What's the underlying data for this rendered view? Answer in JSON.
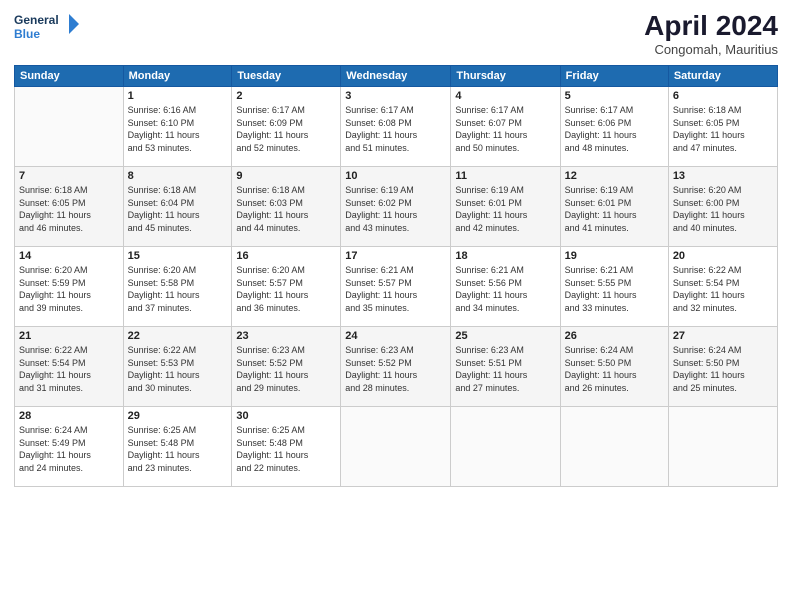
{
  "header": {
    "logo_line1": "General",
    "logo_line2": "Blue",
    "month_year": "April 2024",
    "location": "Congomah, Mauritius"
  },
  "days_of_week": [
    "Sunday",
    "Monday",
    "Tuesday",
    "Wednesday",
    "Thursday",
    "Friday",
    "Saturday"
  ],
  "weeks": [
    [
      {
        "day": "",
        "info": ""
      },
      {
        "day": "1",
        "info": "Sunrise: 6:16 AM\nSunset: 6:10 PM\nDaylight: 11 hours\nand 53 minutes."
      },
      {
        "day": "2",
        "info": "Sunrise: 6:17 AM\nSunset: 6:09 PM\nDaylight: 11 hours\nand 52 minutes."
      },
      {
        "day": "3",
        "info": "Sunrise: 6:17 AM\nSunset: 6:08 PM\nDaylight: 11 hours\nand 51 minutes."
      },
      {
        "day": "4",
        "info": "Sunrise: 6:17 AM\nSunset: 6:07 PM\nDaylight: 11 hours\nand 50 minutes."
      },
      {
        "day": "5",
        "info": "Sunrise: 6:17 AM\nSunset: 6:06 PM\nDaylight: 11 hours\nand 48 minutes."
      },
      {
        "day": "6",
        "info": "Sunrise: 6:18 AM\nSunset: 6:05 PM\nDaylight: 11 hours\nand 47 minutes."
      }
    ],
    [
      {
        "day": "7",
        "info": "Sunrise: 6:18 AM\nSunset: 6:05 PM\nDaylight: 11 hours\nand 46 minutes."
      },
      {
        "day": "8",
        "info": "Sunrise: 6:18 AM\nSunset: 6:04 PM\nDaylight: 11 hours\nand 45 minutes."
      },
      {
        "day": "9",
        "info": "Sunrise: 6:18 AM\nSunset: 6:03 PM\nDaylight: 11 hours\nand 44 minutes."
      },
      {
        "day": "10",
        "info": "Sunrise: 6:19 AM\nSunset: 6:02 PM\nDaylight: 11 hours\nand 43 minutes."
      },
      {
        "day": "11",
        "info": "Sunrise: 6:19 AM\nSunset: 6:01 PM\nDaylight: 11 hours\nand 42 minutes."
      },
      {
        "day": "12",
        "info": "Sunrise: 6:19 AM\nSunset: 6:01 PM\nDaylight: 11 hours\nand 41 minutes."
      },
      {
        "day": "13",
        "info": "Sunrise: 6:20 AM\nSunset: 6:00 PM\nDaylight: 11 hours\nand 40 minutes."
      }
    ],
    [
      {
        "day": "14",
        "info": "Sunrise: 6:20 AM\nSunset: 5:59 PM\nDaylight: 11 hours\nand 39 minutes."
      },
      {
        "day": "15",
        "info": "Sunrise: 6:20 AM\nSunset: 5:58 PM\nDaylight: 11 hours\nand 37 minutes."
      },
      {
        "day": "16",
        "info": "Sunrise: 6:20 AM\nSunset: 5:57 PM\nDaylight: 11 hours\nand 36 minutes."
      },
      {
        "day": "17",
        "info": "Sunrise: 6:21 AM\nSunset: 5:57 PM\nDaylight: 11 hours\nand 35 minutes."
      },
      {
        "day": "18",
        "info": "Sunrise: 6:21 AM\nSunset: 5:56 PM\nDaylight: 11 hours\nand 34 minutes."
      },
      {
        "day": "19",
        "info": "Sunrise: 6:21 AM\nSunset: 5:55 PM\nDaylight: 11 hours\nand 33 minutes."
      },
      {
        "day": "20",
        "info": "Sunrise: 6:22 AM\nSunset: 5:54 PM\nDaylight: 11 hours\nand 32 minutes."
      }
    ],
    [
      {
        "day": "21",
        "info": "Sunrise: 6:22 AM\nSunset: 5:54 PM\nDaylight: 11 hours\nand 31 minutes."
      },
      {
        "day": "22",
        "info": "Sunrise: 6:22 AM\nSunset: 5:53 PM\nDaylight: 11 hours\nand 30 minutes."
      },
      {
        "day": "23",
        "info": "Sunrise: 6:23 AM\nSunset: 5:52 PM\nDaylight: 11 hours\nand 29 minutes."
      },
      {
        "day": "24",
        "info": "Sunrise: 6:23 AM\nSunset: 5:52 PM\nDaylight: 11 hours\nand 28 minutes."
      },
      {
        "day": "25",
        "info": "Sunrise: 6:23 AM\nSunset: 5:51 PM\nDaylight: 11 hours\nand 27 minutes."
      },
      {
        "day": "26",
        "info": "Sunrise: 6:24 AM\nSunset: 5:50 PM\nDaylight: 11 hours\nand 26 minutes."
      },
      {
        "day": "27",
        "info": "Sunrise: 6:24 AM\nSunset: 5:50 PM\nDaylight: 11 hours\nand 25 minutes."
      }
    ],
    [
      {
        "day": "28",
        "info": "Sunrise: 6:24 AM\nSunset: 5:49 PM\nDaylight: 11 hours\nand 24 minutes."
      },
      {
        "day": "29",
        "info": "Sunrise: 6:25 AM\nSunset: 5:48 PM\nDaylight: 11 hours\nand 23 minutes."
      },
      {
        "day": "30",
        "info": "Sunrise: 6:25 AM\nSunset: 5:48 PM\nDaylight: 11 hours\nand 22 minutes."
      },
      {
        "day": "",
        "info": ""
      },
      {
        "day": "",
        "info": ""
      },
      {
        "day": "",
        "info": ""
      },
      {
        "day": "",
        "info": ""
      }
    ]
  ]
}
